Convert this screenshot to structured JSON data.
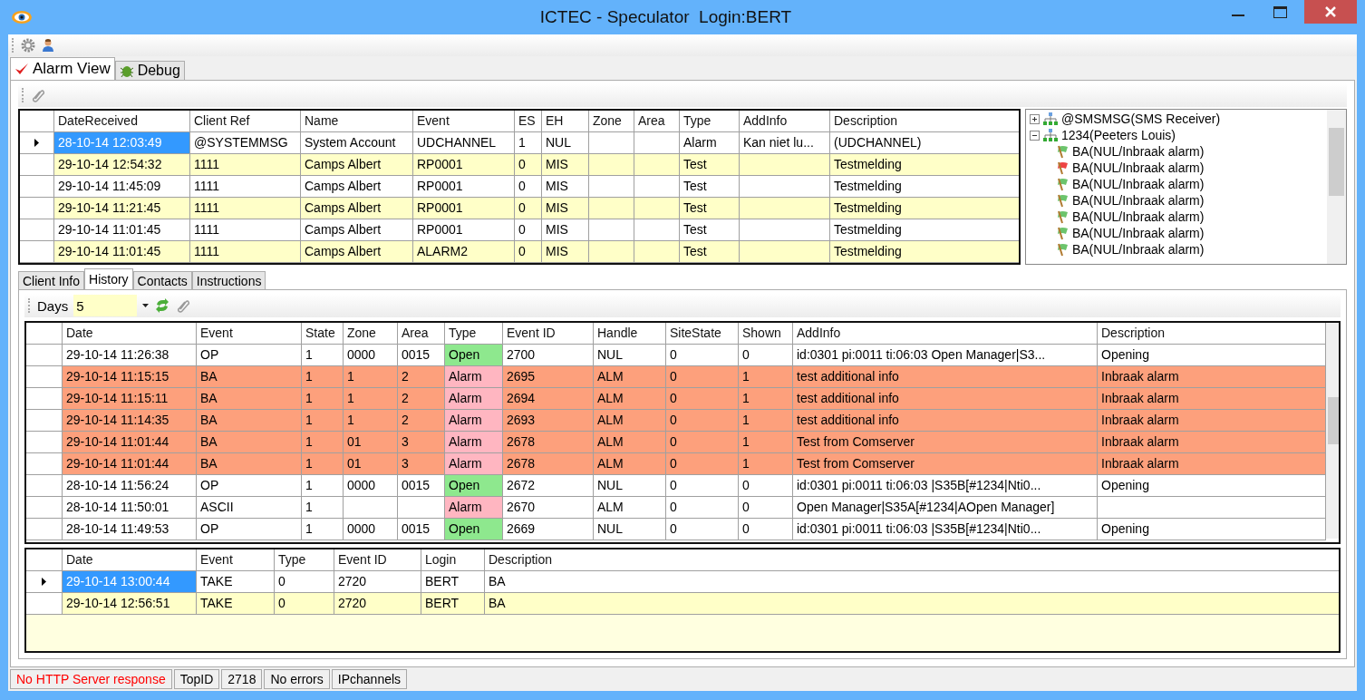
{
  "window": {
    "title": "ICTEC - Speculator  Login:BERT"
  },
  "main_tabs": [
    {
      "label": "Alarm View",
      "selected": true
    },
    {
      "label": "Debug",
      "selected": false
    }
  ],
  "alarm_table": {
    "columns": [
      "DateReceived",
      "Client Ref",
      "Name",
      "Event",
      "ES",
      "EH",
      "Zone",
      "Area",
      "Type",
      "AddInfo",
      "Description"
    ],
    "rows": [
      {
        "selected": true,
        "cells": [
          "28-10-14 12:03:49",
          "@SYSTEMMSG",
          "System Account",
          "UDCHANNEL",
          "1",
          "NUL",
          "",
          "",
          "Alarm",
          "Kan niet lu...",
          "(UDCHANNEL)"
        ]
      },
      {
        "selected": false,
        "cells": [
          "29-10-14 12:54:32",
          "1111",
          "Camps Albert",
          "RP0001",
          "0",
          "MIS",
          "",
          "",
          "Test",
          "",
          "Testmelding"
        ]
      },
      {
        "selected": false,
        "cells": [
          "29-10-14 11:45:09",
          "1111",
          "Camps Albert",
          "RP0001",
          "0",
          "MIS",
          "",
          "",
          "Test",
          "",
          "Testmelding"
        ]
      },
      {
        "selected": false,
        "cells": [
          "29-10-14 11:21:45",
          "1111",
          "Camps Albert",
          "RP0001",
          "0",
          "MIS",
          "",
          "",
          "Test",
          "",
          "Testmelding"
        ]
      },
      {
        "selected": false,
        "cells": [
          "29-10-14 11:01:45",
          "1111",
          "Camps Albert",
          "RP0001",
          "0",
          "MIS",
          "",
          "",
          "Test",
          "",
          "Testmelding"
        ]
      },
      {
        "selected": false,
        "cells": [
          "29-10-14 11:01:45",
          "1111",
          "Camps Albert",
          "ALARM2",
          "0",
          "MIS",
          "",
          "",
          "Test",
          "",
          "Testmelding"
        ]
      }
    ]
  },
  "tree": {
    "items": [
      {
        "label": "@SMSMSG(SMS Receiver)",
        "expanded": false
      },
      {
        "label": "1234(Peeters Louis)",
        "expanded": true,
        "children": [
          {
            "label": "BA(NUL/Inbraak alarm)",
            "color": "#6cc46c"
          },
          {
            "label": "BA(NUL/Inbraak alarm)",
            "color": "#ee4444"
          },
          {
            "label": "BA(NUL/Inbraak alarm)",
            "color": "#6cc46c"
          },
          {
            "label": "BA(NUL/Inbraak alarm)",
            "color": "#6cc46c"
          },
          {
            "label": "BA(NUL/Inbraak alarm)",
            "color": "#6cc46c"
          },
          {
            "label": "BA(NUL/Inbraak alarm)",
            "color": "#6cc46c"
          },
          {
            "label": "BA(NUL/Inbraak alarm)",
            "color": "#6cc46c"
          }
        ]
      }
    ]
  },
  "detail_tabs": [
    {
      "label": "Client Info",
      "selected": false
    },
    {
      "label": "History",
      "selected": true
    },
    {
      "label": "Contacts",
      "selected": false
    },
    {
      "label": "Instructions",
      "selected": false
    }
  ],
  "history_toolbar": {
    "label": "Days",
    "value": "5"
  },
  "history_table": {
    "columns": [
      "Date",
      "Event",
      "State",
      "Zone",
      "Area",
      "Type",
      "Event ID",
      "Handle",
      "SiteState",
      "Shown",
      "AddInfo",
      "Description"
    ],
    "rows": [
      {
        "highlighted": false,
        "color": "#8ee88e",
        "cells": [
          "29-10-14 11:26:38",
          "OP",
          "1",
          "0000",
          "0015",
          "Open",
          "2700",
          "NUL",
          "0",
          "0",
          "id:0301 pi:0011 ti:06:03 Open Manager|S3...",
          "Opening"
        ]
      },
      {
        "highlighted": true,
        "color": "#ffb6c1",
        "cells": [
          "29-10-14 11:15:15",
          "BA",
          "1",
          "1",
          "2",
          "Alarm",
          "2695",
          "ALM",
          "0",
          "1",
          "test additional info",
          "Inbraak alarm"
        ]
      },
      {
        "highlighted": true,
        "color": "#ffb6c1",
        "cells": [
          "29-10-14 11:15:11",
          "BA",
          "1",
          "1",
          "2",
          "Alarm",
          "2694",
          "ALM",
          "0",
          "1",
          "test additional info",
          "Inbraak alarm"
        ]
      },
      {
        "highlighted": true,
        "color": "#ffb6c1",
        "cells": [
          "29-10-14 11:14:35",
          "BA",
          "1",
          "1",
          "2",
          "Alarm",
          "2693",
          "ALM",
          "0",
          "1",
          "test additional info",
          "Inbraak alarm"
        ]
      },
      {
        "highlighted": true,
        "color": "#ffb6c1",
        "cells": [
          "29-10-14 11:01:44",
          "BA",
          "1",
          "01",
          "3",
          "Alarm",
          "2678",
          "ALM",
          "0",
          "1",
          "Test from Comserver",
          "Inbraak alarm"
        ]
      },
      {
        "highlighted": true,
        "color": "#ffb6c1",
        "cells": [
          "29-10-14 11:01:44",
          "BA",
          "1",
          "01",
          "3",
          "Alarm",
          "2678",
          "ALM",
          "0",
          "1",
          "Test from Comserver",
          "Inbraak alarm"
        ]
      },
      {
        "highlighted": false,
        "color": "#8ee88e",
        "cells": [
          "28-10-14 11:56:24",
          "OP",
          "1",
          "0000",
          "0015",
          "Open",
          "2672",
          "NUL",
          "0",
          "0",
          "id:0301 pi:0011 ti:06:03 |S35B[#1234|Nti0...",
          "Opening"
        ]
      },
      {
        "highlighted": false,
        "color": "#ffb6c1",
        "cells": [
          "28-10-14 11:50:01",
          "ASCII",
          "1",
          "",
          "",
          "Alarm",
          "2670",
          "ALM",
          "0",
          "0",
          "Open Manager|S35A[#1234|AOpen Manager]",
          ""
        ]
      },
      {
        "highlighted": false,
        "color": "#8ee88e",
        "cells": [
          "28-10-14 11:49:53",
          "OP",
          "1",
          "0000",
          "0015",
          "Open",
          "2669",
          "NUL",
          "0",
          "0",
          "id:0301 pi:0011 ti:06:03 |S35B[#1234|Nti0...",
          "Opening"
        ]
      }
    ]
  },
  "actions_table": {
    "columns": [
      "Date",
      "Event",
      "Type",
      "Event ID",
      "Login",
      "Description"
    ],
    "rows": [
      {
        "selected": true,
        "cells": [
          "29-10-14 13:00:44",
          "TAKE",
          "0",
          "2720",
          "BERT",
          "BA"
        ]
      },
      {
        "selected": false,
        "cells": [
          "29-10-14 12:56:51",
          "TAKE",
          "0",
          "2720",
          "BERT",
          "BA"
        ]
      }
    ]
  },
  "status_bar": [
    {
      "text": "No HTTP Server response",
      "kind": "error"
    },
    {
      "text": "TopID",
      "kind": "normal"
    },
    {
      "text": "2718",
      "kind": "normal"
    },
    {
      "text": "No errors",
      "kind": "normal"
    },
    {
      "text": "IPchannels",
      "kind": "normal"
    }
  ]
}
